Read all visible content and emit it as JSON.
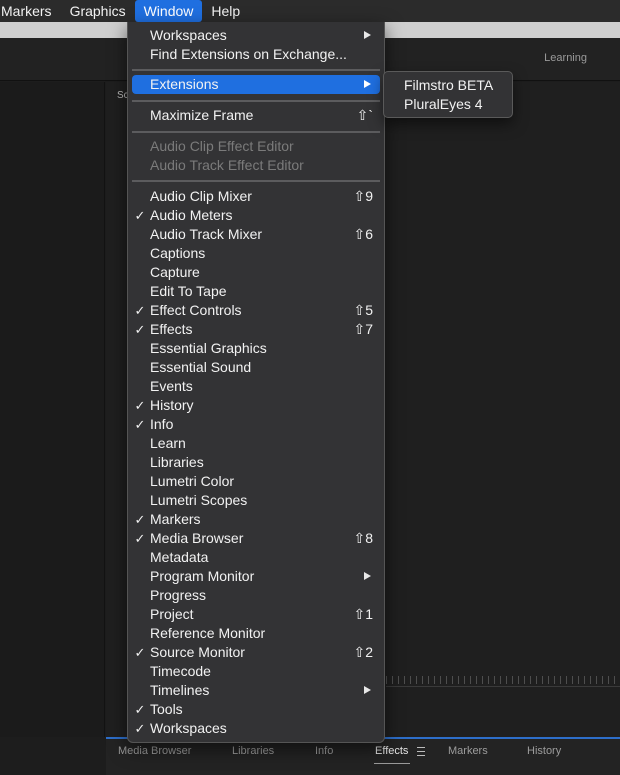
{
  "menubar": {
    "items": [
      "Markers",
      "Graphics",
      "Window",
      "Help"
    ]
  },
  "workspace_tab": "Learning",
  "panel_tab_fragment": "Sc",
  "bottom_tabs": [
    "Media Browser",
    "Libraries",
    "Info",
    "Effects",
    "Markers",
    "History"
  ],
  "window_menu": {
    "workspaces": {
      "label": "Workspaces"
    },
    "find_extensions": {
      "label": "Find Extensions on Exchange..."
    },
    "extensions": {
      "label": "Extensions"
    },
    "maximize_frame": {
      "label": "Maximize Frame",
      "shortcut": "⇧`"
    },
    "audio_clip_effect_editor": {
      "label": "Audio Clip Effect Editor"
    },
    "audio_track_effect_editor": {
      "label": "Audio Track Effect Editor"
    },
    "panels": [
      {
        "label": "Audio Clip Mixer",
        "checked": false,
        "shortcut": "⇧9"
      },
      {
        "label": "Audio Meters",
        "checked": true,
        "shortcut": ""
      },
      {
        "label": "Audio Track Mixer",
        "checked": false,
        "shortcut": "⇧6"
      },
      {
        "label": "Captions",
        "checked": false,
        "shortcut": ""
      },
      {
        "label": "Capture",
        "checked": false,
        "shortcut": ""
      },
      {
        "label": "Edit To Tape",
        "checked": false,
        "shortcut": ""
      },
      {
        "label": "Effect Controls",
        "checked": true,
        "shortcut": "⇧5"
      },
      {
        "label": "Effects",
        "checked": true,
        "shortcut": "⇧7"
      },
      {
        "label": "Essential Graphics",
        "checked": false,
        "shortcut": ""
      },
      {
        "label": "Essential Sound",
        "checked": false,
        "shortcut": ""
      },
      {
        "label": "Events",
        "checked": false,
        "shortcut": ""
      },
      {
        "label": "History",
        "checked": true,
        "shortcut": ""
      },
      {
        "label": "Info",
        "checked": true,
        "shortcut": ""
      },
      {
        "label": "Learn",
        "checked": false,
        "shortcut": ""
      },
      {
        "label": "Libraries",
        "checked": false,
        "shortcut": ""
      },
      {
        "label": "Lumetri Color",
        "checked": false,
        "shortcut": ""
      },
      {
        "label": "Lumetri Scopes",
        "checked": false,
        "shortcut": ""
      },
      {
        "label": "Markers",
        "checked": true,
        "shortcut": ""
      },
      {
        "label": "Media Browser",
        "checked": true,
        "shortcut": "⇧8"
      },
      {
        "label": "Metadata",
        "checked": false,
        "shortcut": ""
      },
      {
        "label": "Program Monitor",
        "checked": false,
        "shortcut": "",
        "submenu": true
      },
      {
        "label": "Progress",
        "checked": false,
        "shortcut": ""
      },
      {
        "label": "Project",
        "checked": false,
        "shortcut": "⇧1"
      },
      {
        "label": "Reference Monitor",
        "checked": false,
        "shortcut": ""
      },
      {
        "label": "Source Monitor",
        "checked": true,
        "shortcut": "⇧2"
      },
      {
        "label": "Timecode",
        "checked": false,
        "shortcut": ""
      },
      {
        "label": "Timelines",
        "checked": false,
        "shortcut": "",
        "submenu": true
      },
      {
        "label": "Tools",
        "checked": true,
        "shortcut": ""
      },
      {
        "label": "Workspaces",
        "checked": true,
        "shortcut": ""
      }
    ]
  },
  "extensions_submenu": {
    "items": [
      "Filmstro BETA",
      "PluralEyes 4"
    ]
  },
  "colors": {
    "highlight": "#1f6fe0",
    "menu_bg": "#333335",
    "app_bg": "#1d1d1d",
    "active_tab_underline": "#2d6ec9"
  }
}
